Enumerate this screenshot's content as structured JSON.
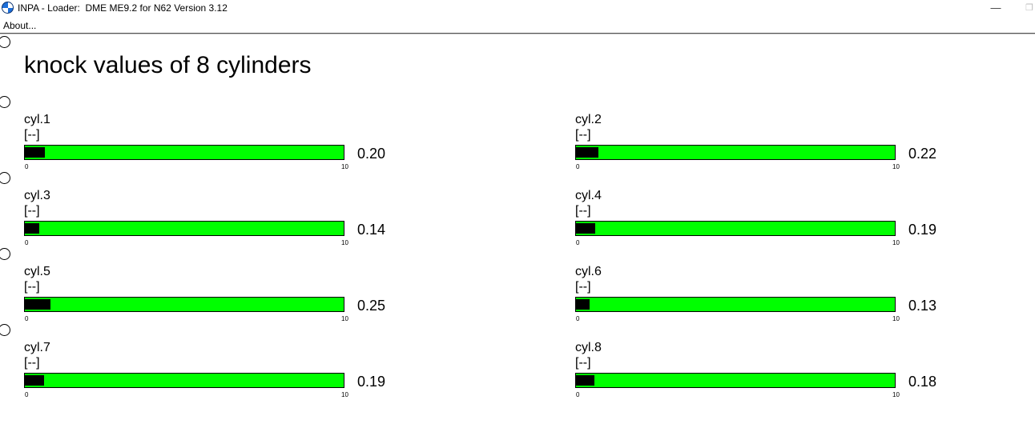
{
  "window": {
    "title": "INPA - Loader:  DME ME9.2 for N62 Version 3.12",
    "minimize_glyph": "—",
    "restore_glyph": "❐",
    "icon": "bmw-logo-icon"
  },
  "menu": {
    "items": [
      {
        "label": "About..."
      }
    ]
  },
  "page": {
    "title": "knock values of 8 cylinders"
  },
  "gauges": [
    {
      "name": "cyl.1",
      "unit": "[--]",
      "min": "0",
      "max": "10",
      "value": "0.20",
      "level": 0.2
    },
    {
      "name": "cyl.2",
      "unit": "[--]",
      "min": "0",
      "max": "10",
      "value": "0.22",
      "level": 0.22
    },
    {
      "name": "cyl.3",
      "unit": "[--]",
      "min": "0",
      "max": "10",
      "value": "0.14",
      "level": 0.14
    },
    {
      "name": "cyl.4",
      "unit": "[--]",
      "min": "0",
      "max": "10",
      "value": "0.19",
      "level": 0.19
    },
    {
      "name": "cyl.5",
      "unit": "[--]",
      "min": "0",
      "max": "10",
      "value": "0.25",
      "level": 0.25
    },
    {
      "name": "cyl.6",
      "unit": "[--]",
      "min": "0",
      "max": "10",
      "value": "0.13",
      "level": 0.13
    },
    {
      "name": "cyl.7",
      "unit": "[--]",
      "min": "0",
      "max": "10",
      "value": "0.19",
      "level": 0.19
    },
    {
      "name": "cyl.8",
      "unit": "[--]",
      "min": "0",
      "max": "10",
      "value": "0.18",
      "level": 0.18
    }
  ],
  "colors": {
    "bar": "#00ff00",
    "bar_fill": "#000000"
  }
}
